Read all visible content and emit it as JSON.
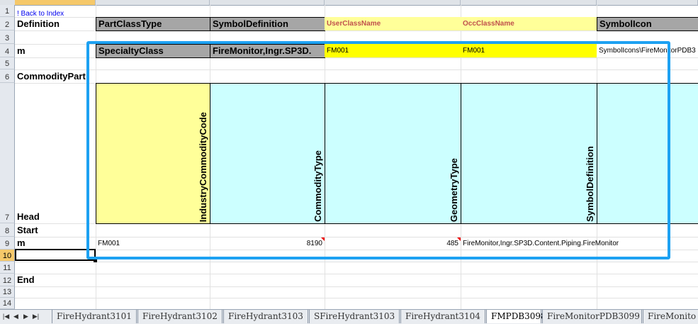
{
  "row_numbers": [
    "1",
    "2",
    "3",
    "4",
    "5",
    "6",
    "7",
    "8",
    "9",
    "10",
    "11",
    "12",
    "13",
    "14"
  ],
  "back_link": "! Back to Index",
  "labels": {
    "definition": "Definition",
    "m1": "m",
    "commodity_part": "CommodityPart",
    "head": "Head",
    "start": "Start",
    "m2": "m",
    "end": "End"
  },
  "definition_headers": [
    "PartClassType",
    "SymbolDefinition",
    "UserClassName",
    "OccClassName",
    "SymbolIcon"
  ],
  "definition_values": [
    "SpecialtyClass",
    "FireMonitor,Ingr.SP3D.",
    "FM001",
    "FM001",
    "SymbolIcons\\FireMonitorPDB3"
  ],
  "part_headers": [
    "IndustryCommodityCode",
    "CommodityType",
    "GeometryType",
    "SymbolDefinition"
  ],
  "part_values": [
    "FM001",
    "8190",
    "485",
    "FireMonitor,Ingr.SP3D.Content.Piping.FireMonitor"
  ],
  "nav_buttons": [
    "|◀",
    "◀",
    "▶",
    "▶|"
  ],
  "sheet_tabs": [
    "FireHydrant3101",
    "FireHydrant3102",
    "FireHydrant3103",
    "SFireHydrant3103",
    "FireHydrant3104",
    "FMPDB3098",
    "FireMonitorPDB3099",
    "FireMonito"
  ],
  "active_tab": "FMPDB3098",
  "colors": {
    "highlight": "#1da1f2",
    "header_gray": "#a6a6a6",
    "light_yellow": "#ffff99",
    "yellow": "#ffff00",
    "cyan": "#ccffff",
    "orange_text": "#c0504d"
  }
}
